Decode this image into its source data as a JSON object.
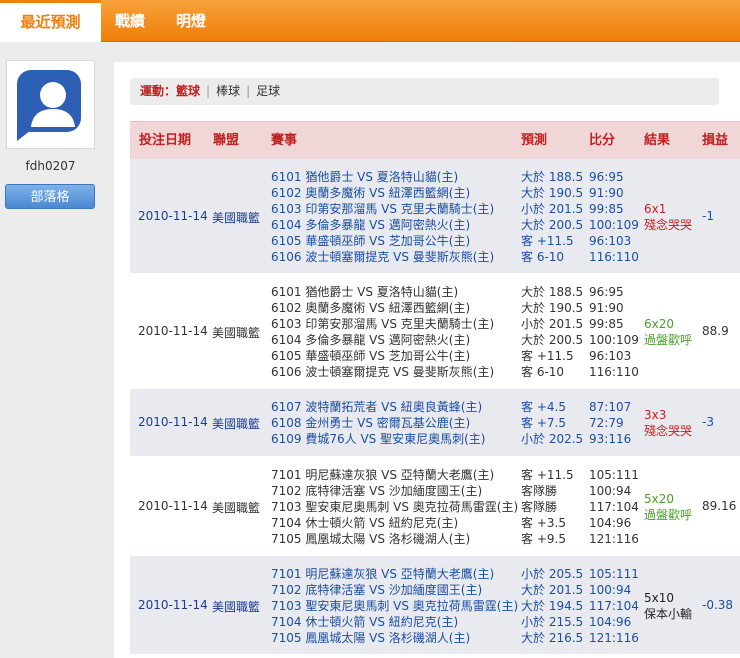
{
  "nav": {
    "tabs": [
      "最近預測",
      "戰績",
      "明燈"
    ]
  },
  "sidebar": {
    "username": "fdh0207",
    "blog_button": "部落格"
  },
  "sportbar": {
    "label": "運動：",
    "items": [
      "籃球",
      "棒球",
      "足球"
    ]
  },
  "table": {
    "headers": [
      "投注日期",
      "聯盟",
      "賽事",
      "預測",
      "比分",
      "結果",
      "損益"
    ],
    "rows": [
      {
        "date": "2010-11-14",
        "league": "美國職籃",
        "games": [
          "6101 猶他爵士 VS 夏洛特山貓(主)",
          "6102 奧蘭多魔術 VS 紐澤西籃網(主)",
          "6103 印第安那溜馬 VS 克里夫蘭騎士(主)",
          "6104 多倫多暴龍 VS 邁阿密熱火(主)",
          "6105 華盛頓巫師 VS 芝加哥公牛(主)",
          "6106 波士頓塞爾提克 VS 曼斐斯灰熊(主)"
        ],
        "preds": [
          "大於 188.5",
          "大於 190.5",
          "小於 201.5",
          "大於 200.5",
          "客 +11.5",
          "客 6-10"
        ],
        "scores": [
          "96:95",
          "91:90",
          "99:85",
          "100:109",
          "96:103",
          "116:110"
        ],
        "result_line1": "6x1",
        "result_line2": "殘念哭哭",
        "profit": "-1"
      },
      {
        "date": "2010-11-14",
        "league": "美國職籃",
        "games": [
          "6101 猶他爵士 VS 夏洛特山貓(主)",
          "6102 奧蘭多魔術 VS 紐澤西籃網(主)",
          "6103 印第安那溜馬 VS 克里夫蘭騎士(主)",
          "6104 多倫多暴龍 VS 邁阿密熱火(主)",
          "6105 華盛頓巫師 VS 芝加哥公牛(主)",
          "6106 波士頓塞爾提克 VS 曼斐斯灰熊(主)"
        ],
        "preds": [
          "大於 188.5",
          "大於 190.5",
          "小於 201.5",
          "大於 200.5",
          "客 +11.5",
          "客 6-10"
        ],
        "scores": [
          "96:95",
          "91:90",
          "99:85",
          "100:109",
          "96:103",
          "116:110"
        ],
        "result_line1": "6x20",
        "result_line2": "過盤歡呼",
        "profit": "88.9"
      },
      {
        "date": "2010-11-14",
        "league": "美國職籃",
        "games": [
          "6107 波特蘭拓荒者 VS 紐奧良黃蜂(主)",
          "6108 金州勇士 VS 密爾瓦基公鹿(主)",
          "6109 費城76人 VS 聖安東尼奧馬刺(主)"
        ],
        "preds": [
          "客 +4.5",
          "客 +7.5",
          "小於 202.5"
        ],
        "scores": [
          "87:107",
          "72:79",
          "93:116"
        ],
        "result_line1": "3x3",
        "result_line2": "殘念哭哭",
        "profit": "-3"
      },
      {
        "date": "2010-11-14",
        "league": "美國職籃",
        "games": [
          "7101 明尼蘇達灰狼 VS 亞特蘭大老鷹(主)",
          "7102 底特律活塞 VS 沙加緬度國王(主)",
          "7103 聖安東尼奧馬刺 VS 奧克拉荷馬雷霆(主)",
          "7104 休士頓火箭 VS 紐約尼克(主)",
          "7105 鳳凰城太陽 VS 洛杉磯湖人(主)"
        ],
        "preds": [
          "客 +11.5",
          "客隊勝",
          "客隊勝",
          "客 +3.5",
          "客 +9.5"
        ],
        "scores": [
          "105:111",
          "100:94",
          "117:104",
          "104:96",
          "121:116"
        ],
        "result_line1": "5x20",
        "result_line2": "過盤歡呼",
        "profit": "89.16"
      },
      {
        "date": "2010-11-14",
        "league": "美國職籃",
        "games": [
          "7101 明尼蘇達灰狼 VS 亞特蘭大老鷹(主)",
          "7102 底特律活塞 VS 沙加緬度國王(主)",
          "7103 聖安東尼奧馬刺 VS 奧克拉荷馬雷霆(主)",
          "7104 休士頓火箭 VS 紐約尼克(主)",
          "7105 鳳凰城太陽 VS 洛杉磯湖人(主)"
        ],
        "preds": [
          "小於 205.5",
          "大於 201.5",
          "大於 194.5",
          "小於 215.5",
          "大於 216.5"
        ],
        "scores": [
          "105:111",
          "100:94",
          "117:104",
          "104:96",
          "121:116"
        ],
        "result_line1": "5x10",
        "result_line2": "保本小輸",
        "profit": "-0.38"
      }
    ]
  }
}
